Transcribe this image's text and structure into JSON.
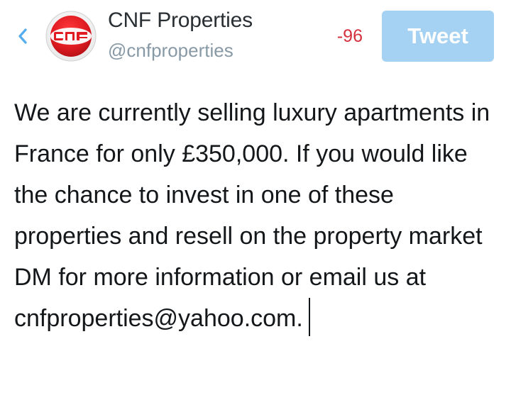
{
  "header": {
    "back_icon": "chevron-left-icon",
    "avatar_icon": "cnf-logo-icon",
    "account_name": "CNF Properties",
    "account_handle": "@cnfproperties",
    "char_counter": "-96",
    "tweet_button_label": "Tweet"
  },
  "compose": {
    "text": "We are currently selling luxury apartments in France for only £350,000. If you would like the chance to invest in one of these properties and resell on the property market DM for more information or email us at cnfproperties@yahoo.com."
  },
  "colors": {
    "accent": "#a5d2f2",
    "back_arrow": "#55acee",
    "counter_over_limit": "#d4313d",
    "logo_red": "#e11b22"
  }
}
